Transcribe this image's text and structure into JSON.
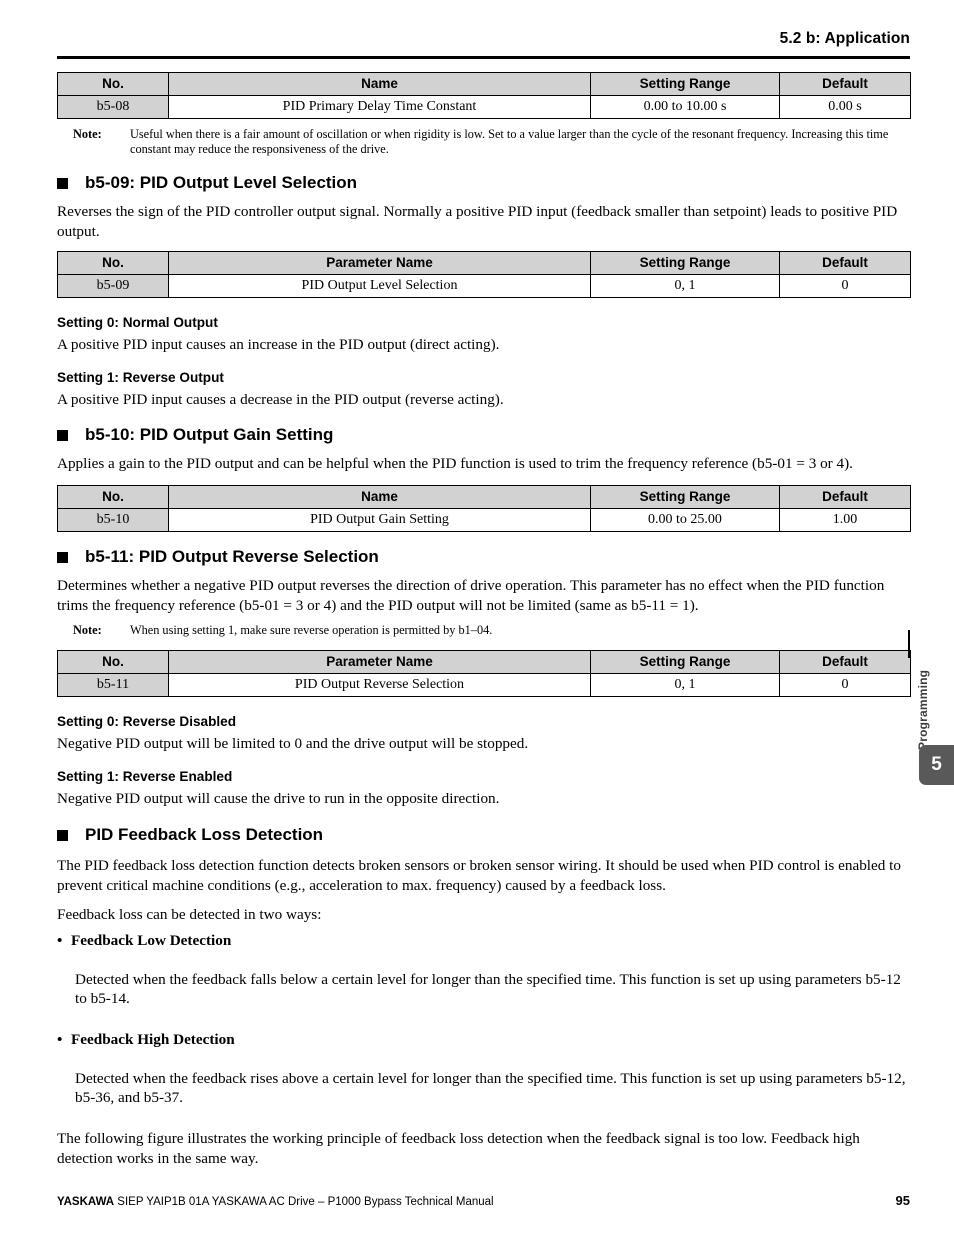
{
  "header": {
    "section_title": "5.2 b: Application"
  },
  "table_headers": {
    "no": "No.",
    "name": "Name",
    "parameter_name": "Parameter Name",
    "setting_range": "Setting Range",
    "default": "Default"
  },
  "tables": {
    "b5_08": {
      "columns": [
        "No.",
        "Name",
        "Setting Range",
        "Default"
      ],
      "row": {
        "no": "b5-08",
        "name": "PID Primary Delay Time Constant",
        "range": "0.00 to 10.00 s",
        "default": "0.00 s"
      }
    },
    "b5_09": {
      "columns": [
        "No.",
        "Parameter Name",
        "Setting Range",
        "Default"
      ],
      "row": {
        "no": "b5-09",
        "name": "PID Output Level Selection",
        "range": "0, 1",
        "default": "0"
      }
    },
    "b5_10": {
      "columns": [
        "No.",
        "Name",
        "Setting Range",
        "Default"
      ],
      "row": {
        "no": "b5-10",
        "name": "PID Output Gain Setting",
        "range": "0.00 to 25.00",
        "default": "1.00"
      }
    },
    "b5_11": {
      "columns": [
        "No.",
        "Parameter Name",
        "Setting Range",
        "Default"
      ],
      "row": {
        "no": "b5-11",
        "name": "PID Output Reverse Selection",
        "range": "0, 1",
        "default": "0"
      }
    }
  },
  "notes": {
    "label": "Note:",
    "b5_08": "Useful when there is a fair amount of oscillation or when rigidity is low. Set to a value larger than the cycle of the resonant frequency. Increasing this time constant may reduce the responsiveness of the drive.",
    "b5_11": "When using setting 1, make sure reverse operation is permitted by b1–04."
  },
  "sections": {
    "b5_09": {
      "heading": "b5-09: PID Output Level Selection",
      "intro": "Reverses the sign of the PID controller output signal. Normally a positive PID input (feedback smaller than setpoint) leads to positive PID output.",
      "setting0_head": "Setting 0: Normal Output",
      "setting0_body": "A positive PID input causes an increase in the PID output (direct acting).",
      "setting1_head": "Setting 1: Reverse Output",
      "setting1_body": "A positive PID input causes a decrease in the PID output (reverse acting)."
    },
    "b5_10": {
      "heading": "b5-10: PID Output Gain Setting",
      "intro": "Applies a gain to the PID output and can be helpful when the PID function is used to trim the frequency reference (b5-01 = 3 or 4)."
    },
    "b5_11": {
      "heading": "b5-11: PID Output Reverse Selection",
      "intro": "Determines whether a negative PID output reverses the direction of drive operation. This parameter has no effect when the PID function trims the frequency reference (b5-01 = 3 or 4) and the PID output will not be limited (same as b5-11 = 1).",
      "setting0_head": "Setting 0: Reverse Disabled",
      "setting0_body": "Negative PID output will be limited to 0 and the drive output will be stopped.",
      "setting1_head": "Setting 1: Reverse Enabled",
      "setting1_body": "Negative PID output will cause the drive to run in the opposite direction."
    },
    "feedback_loss": {
      "heading": "PID Feedback Loss Detection",
      "intro": "The PID feedback loss detection function detects broken sensors or broken sensor wiring. It should be used when PID control is enabled to prevent critical machine conditions (e.g., acceleration to max. frequency) caused by a feedback loss.",
      "two_ways": "Feedback loss can be detected in two ways:",
      "bullet_marker": "•",
      "low_head": "Feedback Low Detection",
      "low_body": "Detected when the feedback falls below a certain level for longer than the specified time. This function is set up using parameters b5-12 to b5-14.",
      "high_head": "Feedback High Detection",
      "high_body": "Detected when the feedback rises above a certain level for longer than the specified time. This function is set up using parameters b5-12, b5-36, and b5-37.",
      "closing": "The following figure illustrates the working principle of feedback loss detection when the feedback signal is too low. Feedback high detection works in the same way."
    }
  },
  "side_tab": {
    "label": "Programming",
    "chapter": "5",
    "color": "#595959"
  },
  "footer": {
    "brand": "YASKAWA",
    "manual": "SIEP YAIP1B 01A YASKAWA AC Drive – P1000 Bypass Technical Manual",
    "page_number": "95"
  }
}
